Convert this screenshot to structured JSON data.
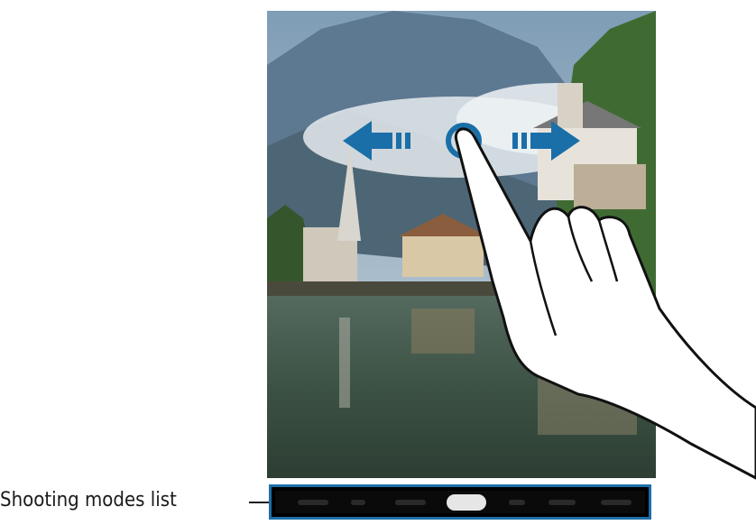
{
  "callout": {
    "label": "Shooting modes list"
  },
  "colors": {
    "accent": "#1d6fa8",
    "mode_bar_bg": "#000000"
  },
  "icons": [
    "swipe-left-arrow-icon",
    "swipe-right-arrow-icon",
    "touch-point-icon",
    "pointing-hand-icon"
  ],
  "mode_bar": {
    "item_count": 7,
    "selected_index": 3
  }
}
